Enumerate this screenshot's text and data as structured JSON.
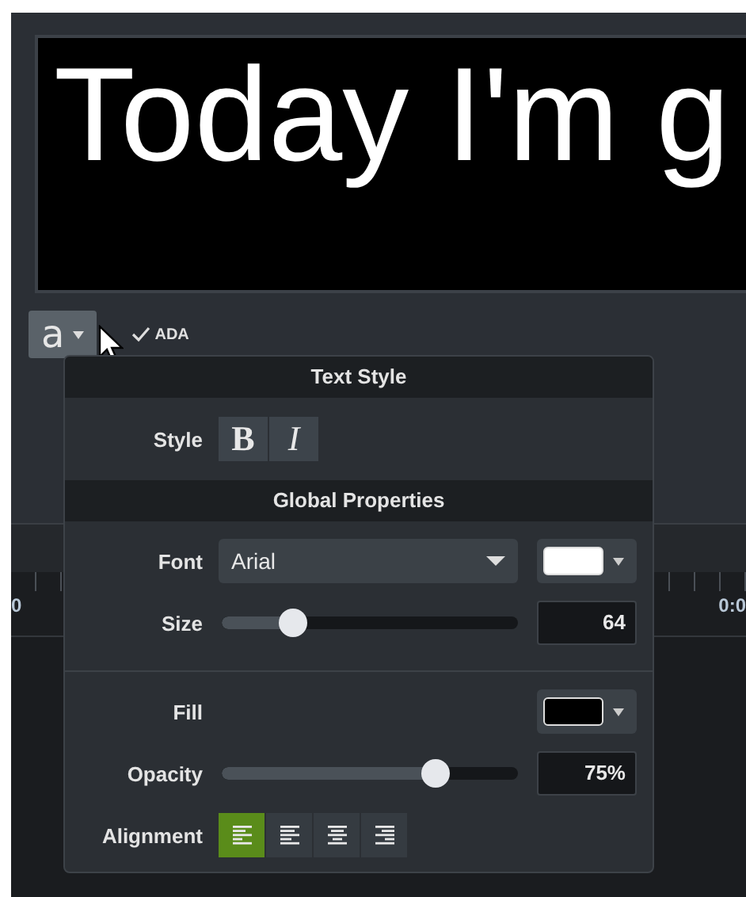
{
  "caption": {
    "text": "Today I'm g"
  },
  "toolbar": {
    "style_button": "a",
    "ada": {
      "label": "ADA",
      "checked": true
    }
  },
  "ruler": {
    "labels": [
      "0",
      "0:0"
    ]
  },
  "popup": {
    "text_style_title": "Text Style",
    "style_label": "Style",
    "styles": [
      {
        "kind": "bold",
        "label": "B",
        "selected": false
      },
      {
        "kind": "italic",
        "label": "I",
        "selected": false
      }
    ],
    "global_title": "Global Properties",
    "font": {
      "label": "Font",
      "value": "Arial",
      "color": "#ffffff"
    },
    "size": {
      "label": "Size",
      "level": 0.24,
      "value": "64"
    },
    "fill": {
      "label": "Fill",
      "color": "#000000"
    },
    "opacity": {
      "label": "Opacity",
      "level": 0.72,
      "value": "75%"
    },
    "alignment": {
      "label": "Alignment",
      "options": [
        {
          "kind": "left",
          "selected": true
        },
        {
          "kind": "justify",
          "selected": false
        },
        {
          "kind": "center",
          "selected": false
        },
        {
          "kind": "right",
          "selected": false
        }
      ]
    }
  }
}
